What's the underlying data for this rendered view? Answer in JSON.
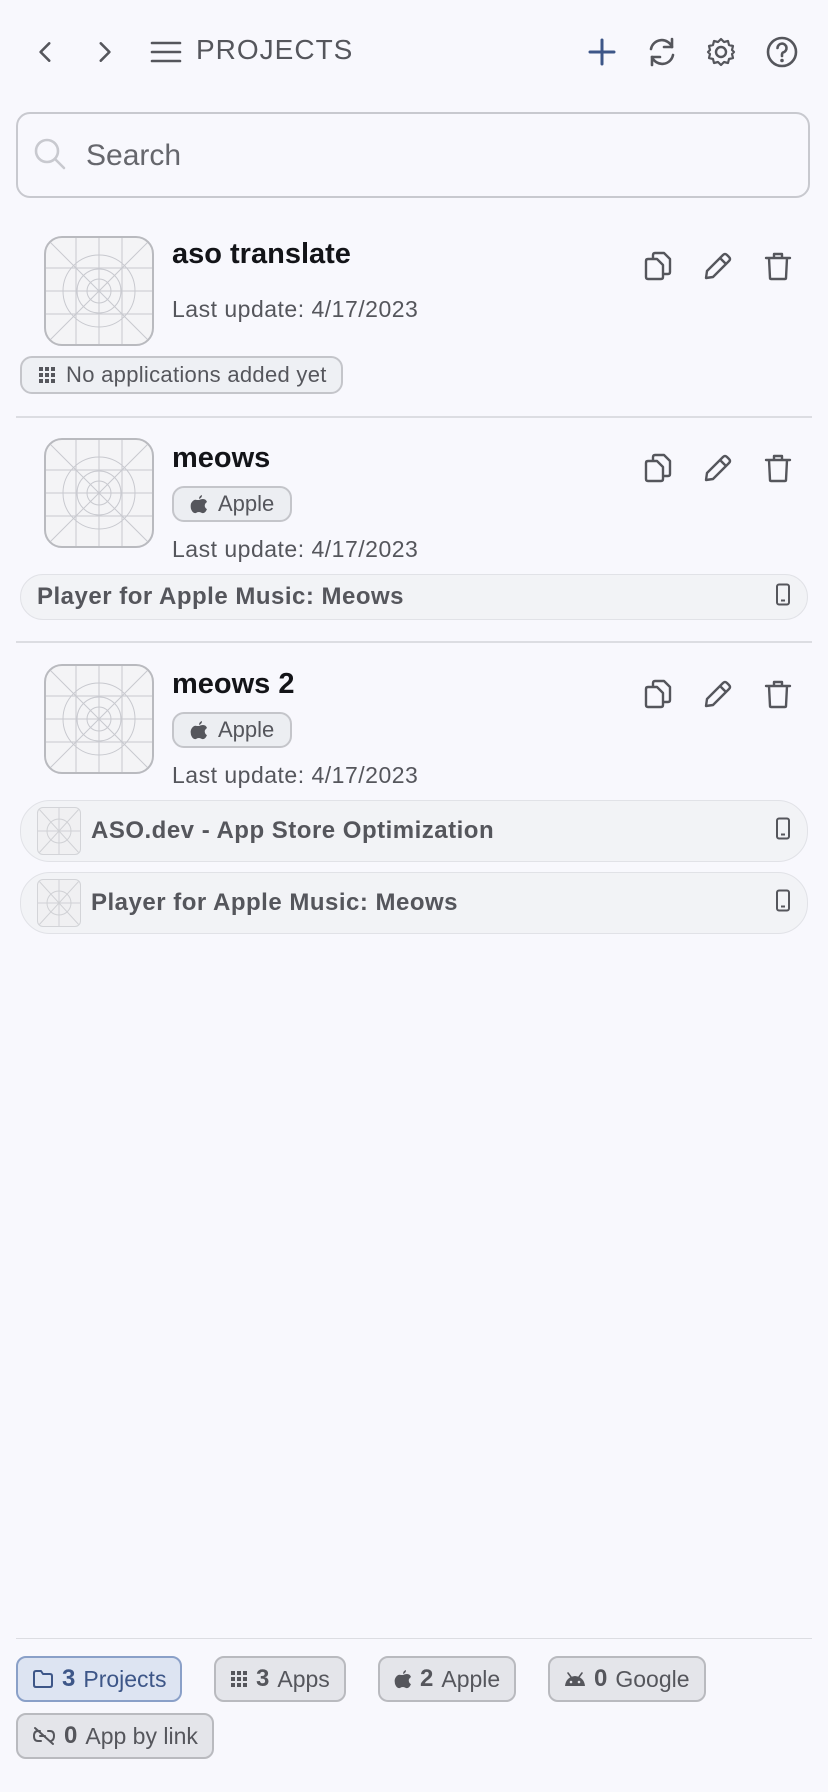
{
  "header": {
    "title": "PROJECTS",
    "accent": "#3d5688"
  },
  "search": {
    "placeholder": "Search"
  },
  "projects": [
    {
      "name": "aso translate",
      "last_update": "Last update: 4/17/2023",
      "store": null,
      "empty_label": "No applications added yet",
      "apps": []
    },
    {
      "name": "meows",
      "last_update": "Last update: 4/17/2023",
      "store": "Apple",
      "apps": [
        {
          "name": "Player for Apple Music: Meows",
          "icon": false
        }
      ]
    },
    {
      "name": "meows 2",
      "last_update": "Last update: 4/17/2023",
      "store": "Apple",
      "apps": [
        {
          "name": "ASO.dev - App Store Optimization",
          "icon": true
        },
        {
          "name": "Player for Apple Music: Meows",
          "icon": true
        }
      ]
    }
  ],
  "stats": [
    {
      "count": "3",
      "label": "Projects",
      "icon": "folder-icon"
    },
    {
      "count": "3",
      "label": "Apps",
      "icon": "grid-icon"
    },
    {
      "count": "2",
      "label": "Apple",
      "icon": "apple-icon"
    },
    {
      "count": "0",
      "label": "Google",
      "icon": "android-icon"
    },
    {
      "count": "0",
      "label": "App by link",
      "icon": "link-off-icon"
    }
  ]
}
